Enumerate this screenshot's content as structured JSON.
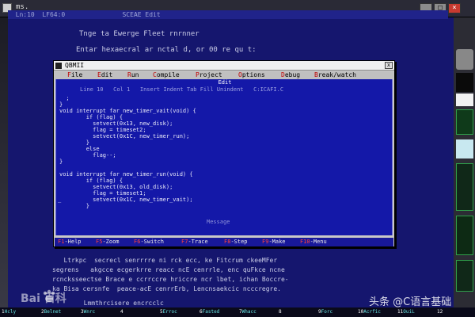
{
  "window": {
    "title": "ms.",
    "minimize": "_",
    "restore": "□",
    "close": "×"
  },
  "dos": {
    "status_line": "  Ln:10  LF64:0               SCEAE Edit",
    "line1": "Tnge ta Ewerge Fleet rnrnner",
    "line2": "Entar hexaecral ar nctal d, or 00 re qu t:",
    "para1": "   Ltrkpc  secrecl senrrrre ni rck ecc, ke Fitcrum ckeeMFer",
    "para2": "segrens   akgcce ecgerkrre reacc ncE cenrrle, enc quFkce ncne",
    "para3": "rcncksseectse Brace e ccrrccre hriccre ncr lbet, ichan Boccre-",
    "para4": "ka Bisa cersnfe  peace-acE cenrrErb, Lencnsaekcic ncccregre.",
    "para5": "  Lmmthrcisere encrcclc"
  },
  "qbasic": {
    "title": "QBMII",
    "close": "x",
    "menu": [
      {
        "hot": "F",
        "rest": "ile"
      },
      {
        "hot": "E",
        "rest": "dit"
      },
      {
        "hot": "R",
        "rest": "un"
      },
      {
        "hot": "C",
        "rest": "ompile"
      },
      {
        "hot": "P",
        "rest": "roject"
      },
      {
        "hot": "O",
        "rest": "ptions"
      },
      {
        "hot": "D",
        "rest": "ebug"
      },
      {
        "hot": "B",
        "rest": "reak/watch"
      }
    ],
    "editor_caption": "Edit",
    "editor_status": "Line 10   Col 1   Insert Indent Tab Fill Unindent   C:ICAFI.C",
    "code": [
      "  ;",
      "}",
      "void interrupt far new_timer_vait(void) {",
      "        if (flag) {",
      "          setvect(0x13, new_disk);",
      "          flag = timeset2;",
      "          setvect(0x1C, new_timer_run);",
      "        }",
      "        else",
      "          flag--;",
      "}",
      "",
      "void interrupt far new_timer_run(void) {",
      "        if (flag) {",
      "          setvect(0x13, old_disk);",
      "          flag = timeset1;",
      "          setvect(0x1C, new_timer_vait);",
      "        }"
    ],
    "cursor": "_",
    "messages": "Message",
    "fkeys": [
      {
        "k": "F1",
        "t": "-Help"
      },
      {
        "k": "F5",
        "t": "-Zoom"
      },
      {
        "k": "F6",
        "t": "-Switch"
      },
      {
        "k": "F7",
        "t": "-Trace"
      },
      {
        "k": "F8",
        "t": "-Step"
      },
      {
        "k": "F9",
        "t": "-Make"
      },
      {
        "k": "F10",
        "t": "-Menu"
      }
    ]
  },
  "bottom_strip": [
    {
      "n": "1",
      "t": "Hcly"
    },
    {
      "n": "2",
      "t": "Belnet"
    },
    {
      "n": "3",
      "t": "Wnrc"
    },
    {
      "n": "4",
      "t": ""
    },
    {
      "n": "5",
      "t": "Erroc"
    },
    {
      "n": "6",
      "t": "Fasted"
    },
    {
      "n": "7",
      "t": "Whacc"
    },
    {
      "n": "8",
      "t": ""
    },
    {
      "n": "9",
      "t": "Forc"
    },
    {
      "n": "10",
      "t": "Acrfic"
    },
    {
      "n": "11",
      "t": "OuiL"
    },
    {
      "n": "12",
      "t": ""
    }
  ],
  "watermarks": {
    "left": "Bai  百科",
    "right": "头条 @C语言基础"
  },
  "colors": {
    "screen": "#15166e",
    "editor": "#1418a8",
    "hotkey": "#c00000"
  }
}
